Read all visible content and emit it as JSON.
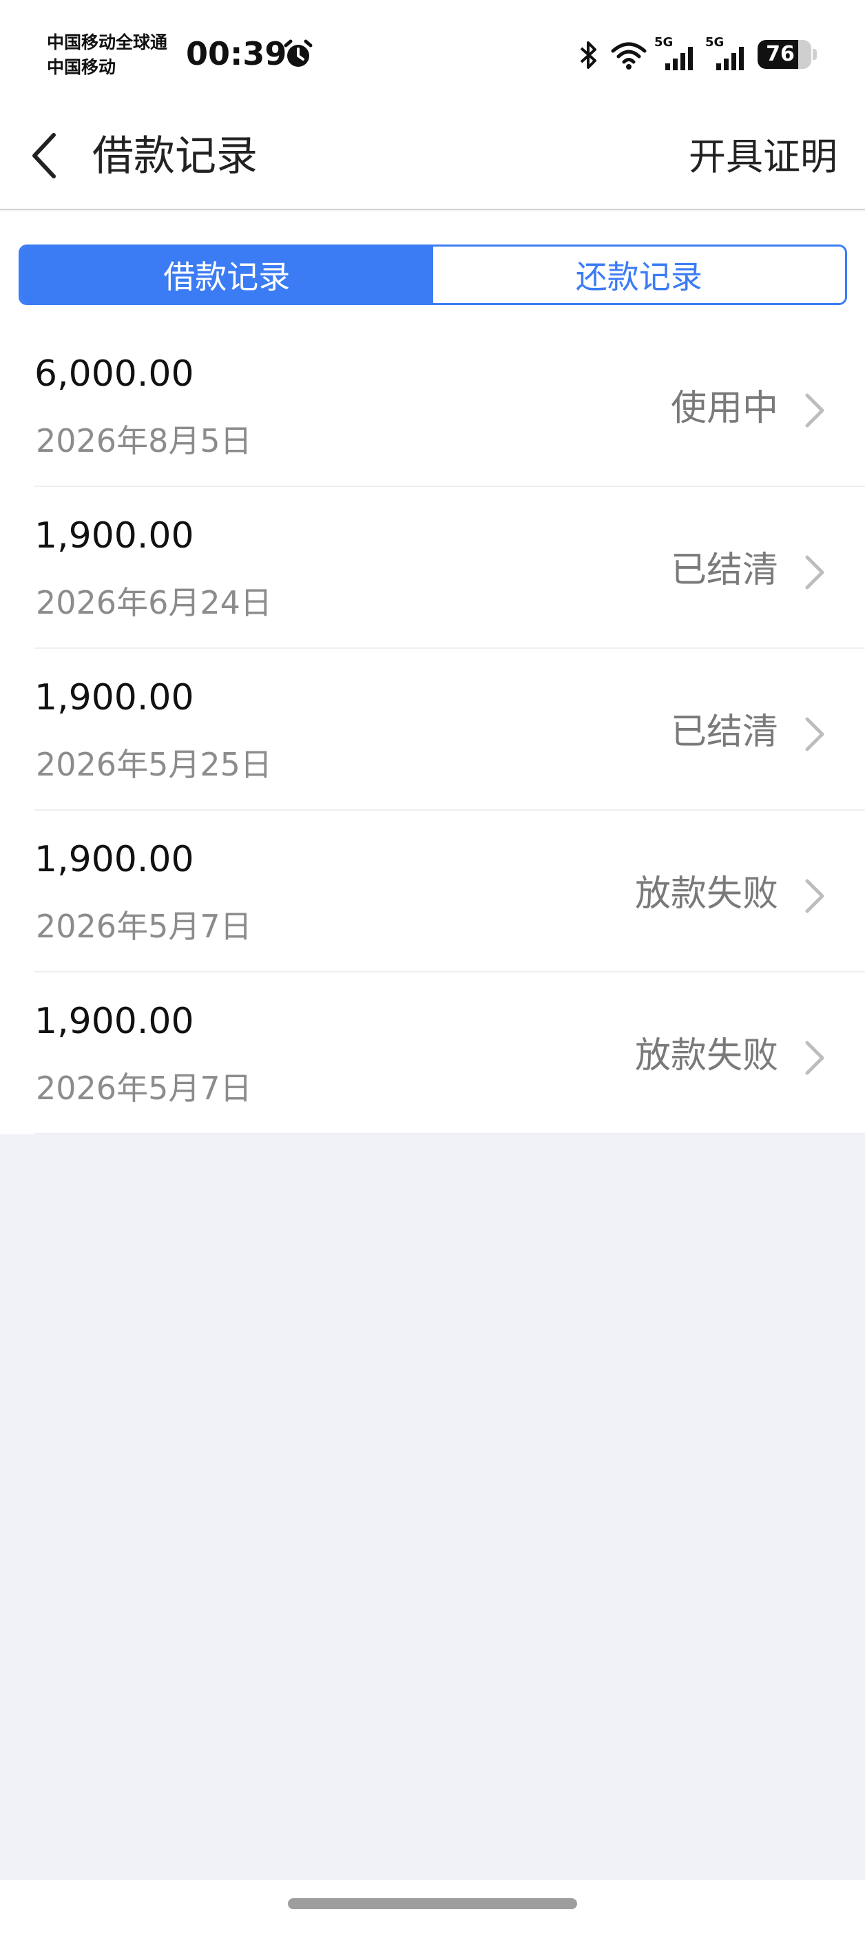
{
  "status_bar": {
    "carrier_line1": "中国移动全球通",
    "carrier_line2": "中国移动",
    "time": "00:39",
    "signal1_label": "5G",
    "signal2_label": "5G",
    "battery_level": "76",
    "battery_fraction": 0.76,
    "icons": [
      "alarm-icon",
      "bluetooth-icon",
      "wifi-icon",
      "signal-icon",
      "battery-icon"
    ]
  },
  "nav": {
    "title": "借款记录",
    "right_button": "开具证明",
    "back_icon": "chevron-left-icon"
  },
  "tabs": [
    {
      "label": "借款记录",
      "active": true
    },
    {
      "label": "还款记录",
      "active": false
    }
  ],
  "records": [
    {
      "amount": "6,000.00",
      "date": "2026年8月5日",
      "status": "使用中"
    },
    {
      "amount": "1,900.00",
      "date": "2026年6月24日",
      "status": "已结清"
    },
    {
      "amount": "1,900.00",
      "date": "2026年5月25日",
      "status": "已结清"
    },
    {
      "amount": "1,900.00",
      "date": "2026年5月7日",
      "status": "放款失败"
    },
    {
      "amount": "1,900.00",
      "date": "2026年5月7日",
      "status": "放款失败"
    }
  ],
  "colors": {
    "accent": "#3b7cf5",
    "background": "#f1f2f7",
    "status_text": "#7a7a7a",
    "date_text": "#8c8c8c"
  }
}
